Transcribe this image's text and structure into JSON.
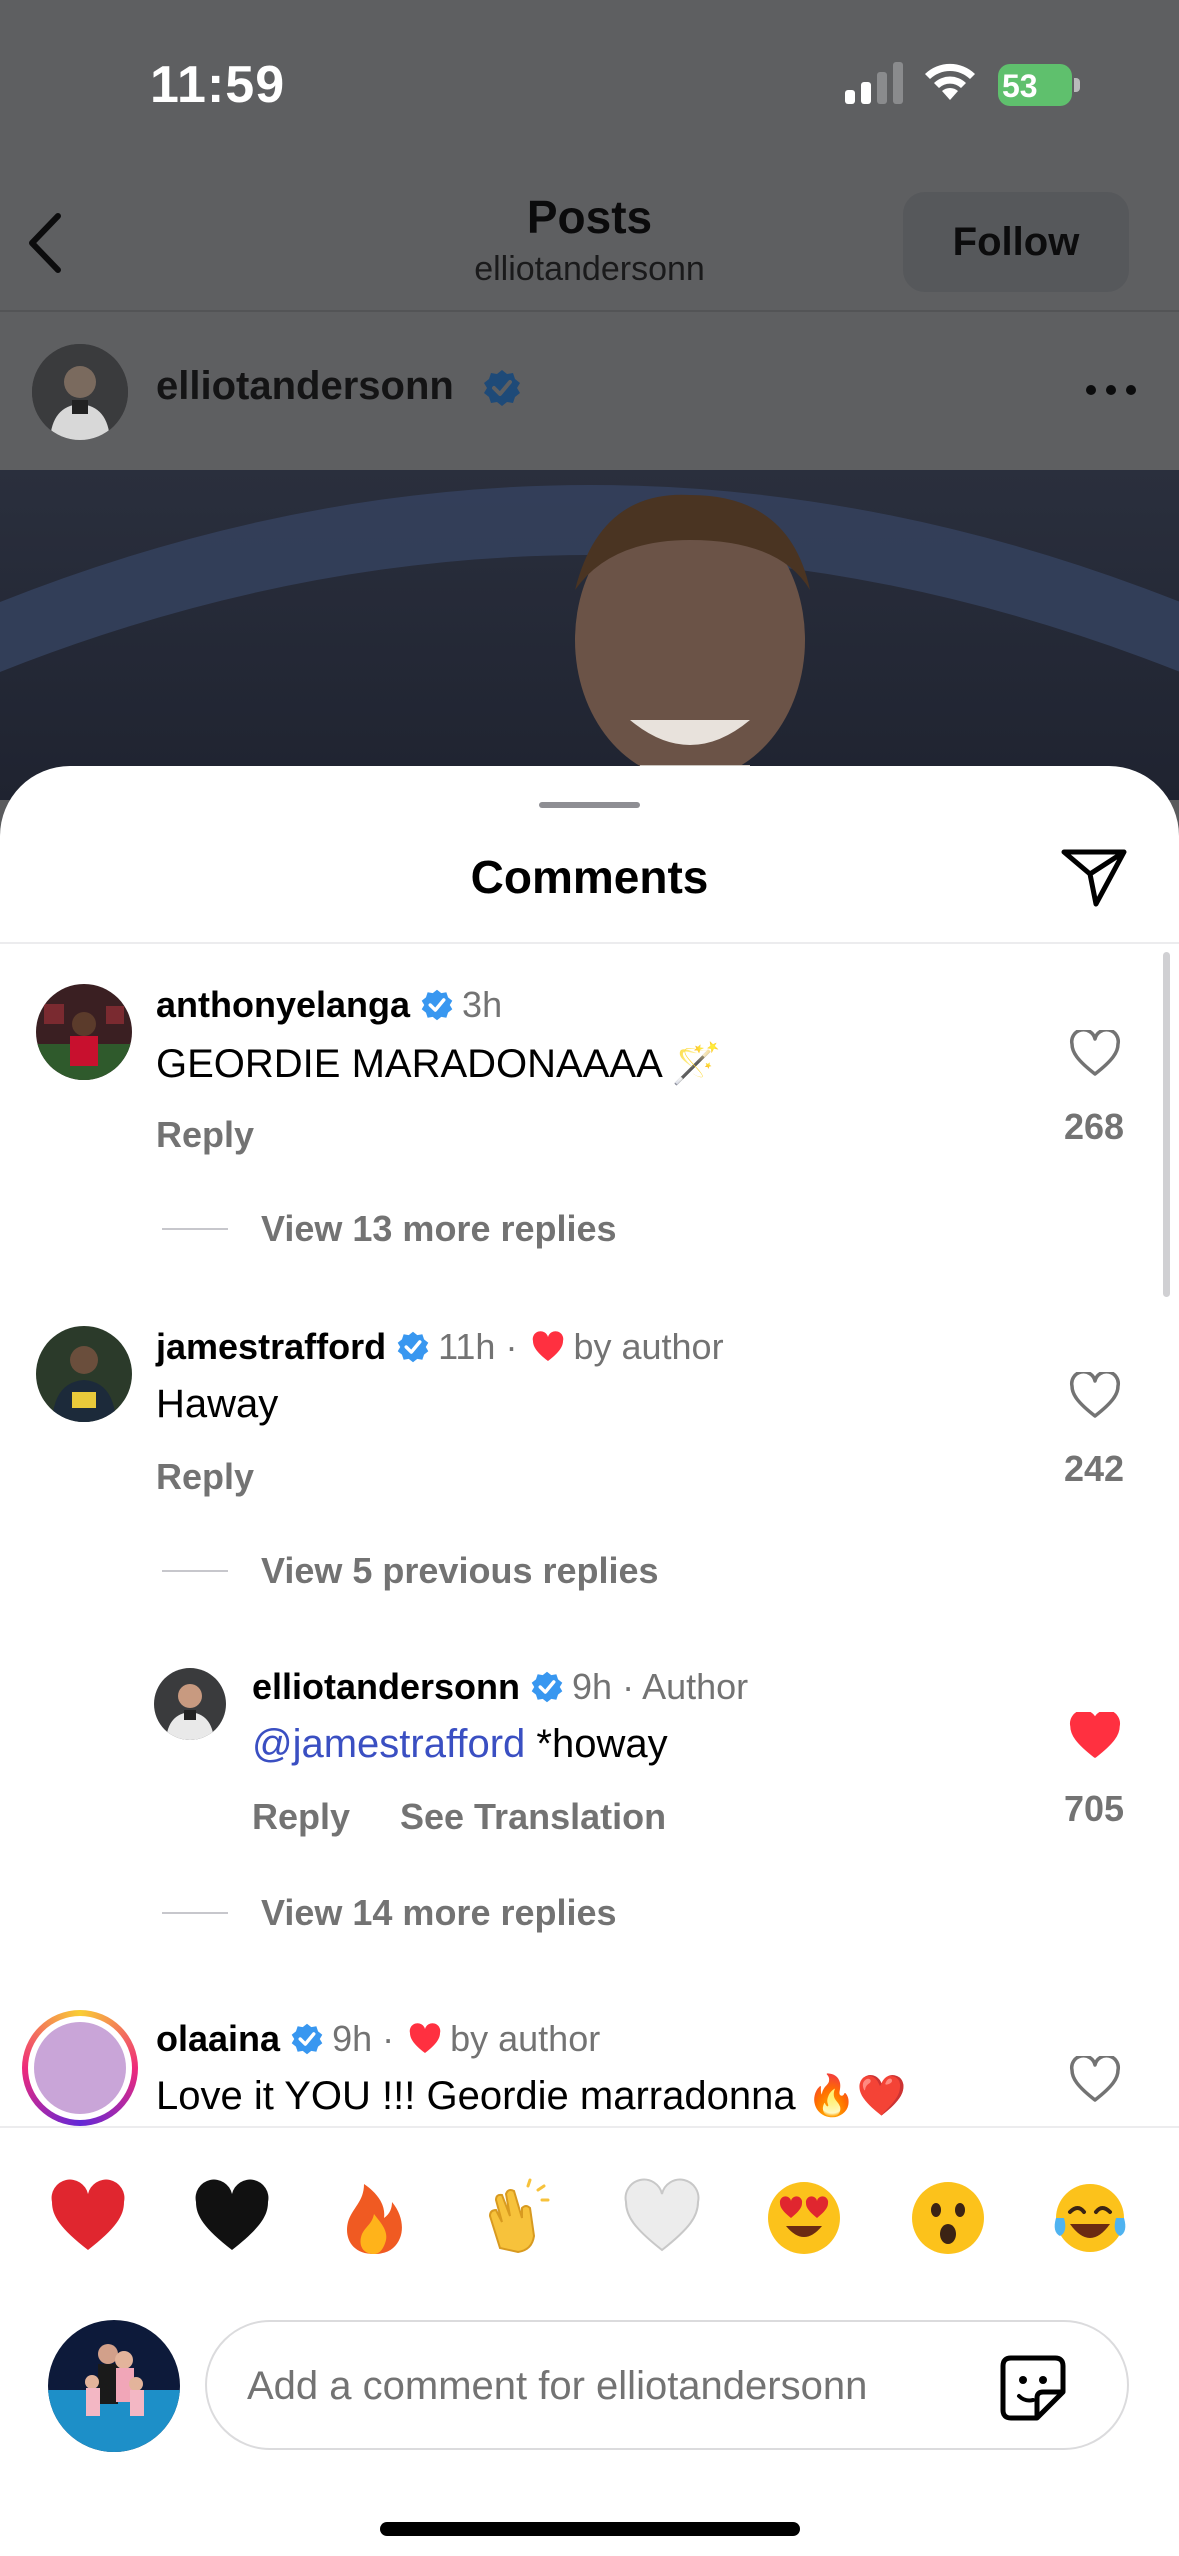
{
  "status_bar": {
    "time": "11:59",
    "battery": "53"
  },
  "nav": {
    "title": "Posts",
    "subtitle": "elliotandersonn",
    "follow_label": "Follow"
  },
  "post": {
    "username": "elliotandersonn"
  },
  "sheet": {
    "title": "Comments"
  },
  "comments": [
    {
      "username": "anthonyelanga",
      "time": "3h",
      "text": "GEORDIE MARADONAAAA 🪄",
      "reply_label": "Reply",
      "likes": "268",
      "view_replies": "View 13 more replies"
    },
    {
      "username": "jamestrafford",
      "time": "11h ·",
      "liked_by": "by author",
      "text": "Haway",
      "reply_label": "Reply",
      "likes": "242",
      "view_replies": "View 5 previous replies"
    },
    {
      "username": "elliotandersonn",
      "time": "9h · Author",
      "mention": "@jamestrafford",
      "text": " *howay",
      "reply_label": "Reply",
      "translate_label": "See Translation",
      "likes": "705",
      "view_replies": "View 14 more replies"
    },
    {
      "username": "olaaina",
      "time": "9h ·",
      "liked_by": "by author",
      "text": "Love it YOU !!! Geordie marradonna 🔥❤️"
    }
  ],
  "reactions": [
    "❤️",
    "🖤",
    "🔥",
    "👏",
    "🤍",
    "😍",
    "😮",
    "😂"
  ],
  "composer": {
    "placeholder": "Add a comment for elliotandersonn"
  },
  "colors": {
    "like_red": "#ff3040",
    "verified_blue": "#3897f0",
    "muted": "#737373",
    "mention": "#3a4fc2"
  }
}
